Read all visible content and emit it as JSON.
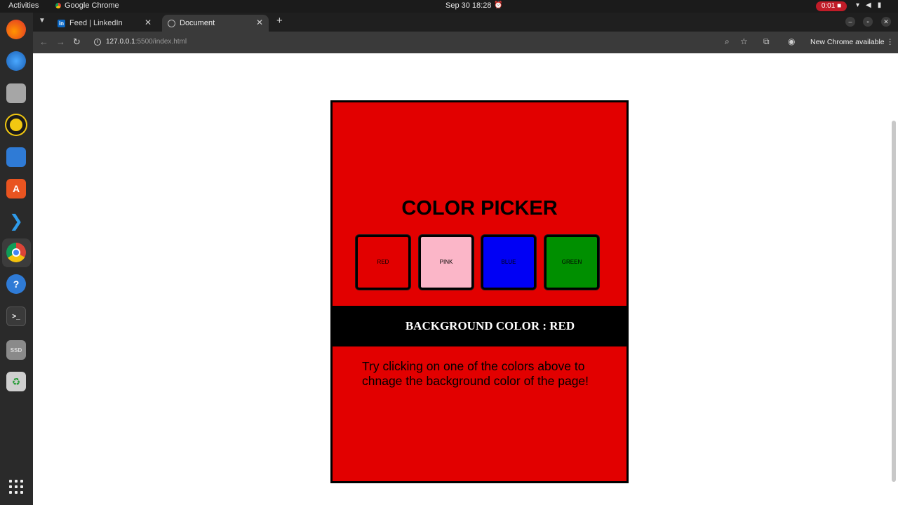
{
  "system": {
    "activities_label": "Activities",
    "app_name": "Google Chrome",
    "clock": "Sep 30  18:28",
    "recording_time": "0:01"
  },
  "browser": {
    "tabs": [
      {
        "label": "Feed | LinkedIn",
        "favicon": "linkedin-icon",
        "active": false
      },
      {
        "label": "Document",
        "favicon": "globe-icon",
        "active": true
      }
    ],
    "url_host": "127.0.0.1",
    "url_rest": ":5500/index.html",
    "update_label": "New Chrome available"
  },
  "page": {
    "title": "COLOR PICKER",
    "swatches": [
      {
        "label": "RED",
        "color": "#e20000"
      },
      {
        "label": "PINK",
        "color": "#fbb6c8"
      },
      {
        "label": "BLUE",
        "color": "#0000f5"
      },
      {
        "label": "GREEN",
        "color": "#008f00"
      }
    ],
    "banner": "BACKGROUND COLOR : RED",
    "hint": "Try clicking on one of the colors above to chnage the background color of the page!",
    "background_color": "#e20000"
  }
}
